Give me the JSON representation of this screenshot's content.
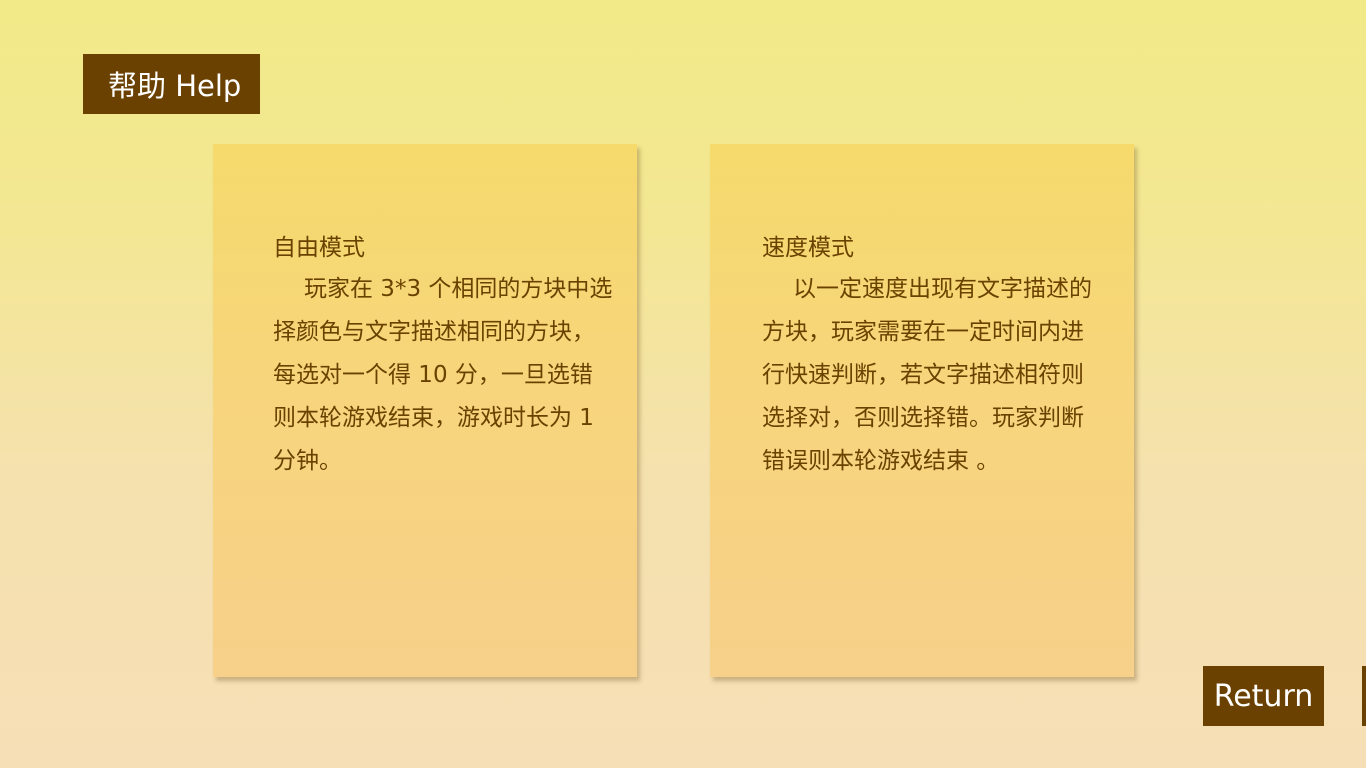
{
  "header": {
    "title": "帮助 Help"
  },
  "cards": [
    {
      "heading": "自由模式",
      "body": "玩家在 3*3 个相同的方块中选择颜色与文字描述相同的方块，每选对一个得 10 分，一旦选错则本轮游戏结束，游戏时长为 1 分钟。"
    },
    {
      "heading": "速度模式",
      "body": "以一定速度出现有文字描述的方块，玩家需要在一定时间内进行快速判断，若文字描述相符则选择对，否则选择错。玩家判断错误则本轮游戏结束 。"
    }
  ],
  "footer": {
    "return_label": "Return"
  },
  "colors": {
    "accent_brown": "#6a4100",
    "text_brown": "#6a4200",
    "card_yellow": "#f6da6c",
    "background_top": "#f2ea88",
    "background_bottom": "#f6dfb6"
  }
}
